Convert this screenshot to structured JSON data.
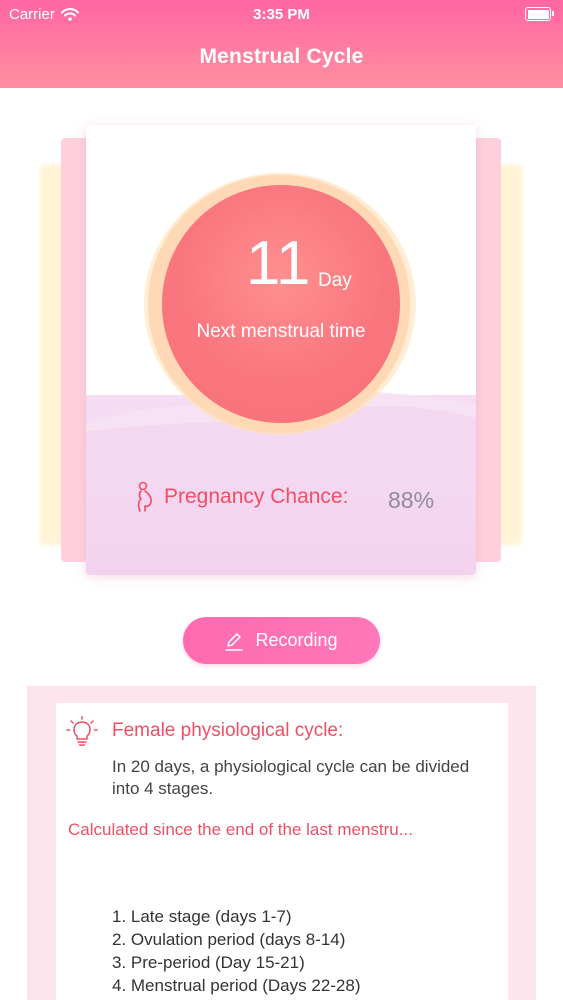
{
  "status_bar": {
    "carrier": "Carrier",
    "time": "3:35 PM"
  },
  "nav": {
    "title": "Menstrual Cycle"
  },
  "cycle_card": {
    "day_number": "11",
    "day_unit": "Day",
    "next_label": "Next menstrual time",
    "pregnancy_label": "Pregnancy Chance:",
    "pregnancy_value": "88%"
  },
  "record_button": {
    "label": "Recording"
  },
  "info": {
    "title": "Female physiological cycle:",
    "description": "In 20 days, a physiological cycle can be divided into 4 stages.",
    "calculation_note": "Calculated since the end of the last menstru...",
    "stages": [
      "1. Late stage (days 1-7)",
      "2. Ovulation period (days 8-14)",
      "3. Pre-period (Day 15-21)",
      "4. Menstrual period (Days 22-28)"
    ]
  },
  "icons": {
    "wifi": "wifi-icon",
    "battery": "battery-icon",
    "pregnancy": "pregnant-woman-icon",
    "pencil": "pencil-icon",
    "bulb": "lightbulb-icon"
  },
  "colors": {
    "header_start": "#ff66a3",
    "header_end": "#ff8fa0",
    "accent_red": "#f04e64",
    "circle": "#f9767e",
    "button": "#ff6ab0",
    "info_bg": "#fde4ed"
  }
}
